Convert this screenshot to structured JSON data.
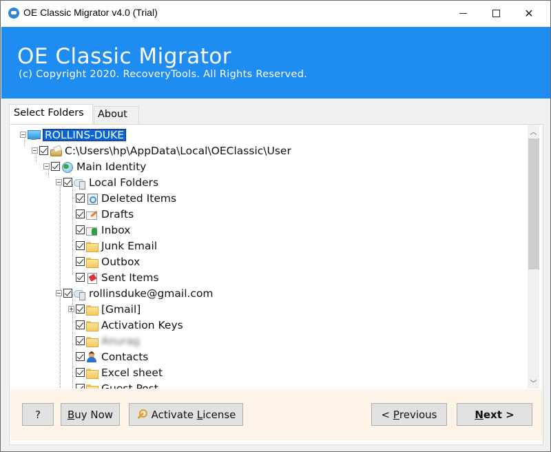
{
  "window": {
    "title": "OE Classic Migrator v4.0 (Trial)",
    "controls": [
      "minimize",
      "maximize",
      "close"
    ]
  },
  "banner": {
    "title": "OE Classic Migrator",
    "copyright": "(c) Copyright 2020. RecoveryTools. All Rights Reserved.",
    "background_color": "#1e8cf0"
  },
  "tabs": [
    {
      "label": "Select Folders",
      "active": true
    },
    {
      "label": "About",
      "active": false
    }
  ],
  "tree": {
    "root": {
      "label": "ROLLINS-DUKE",
      "icon": "computer-icon",
      "selected": true
    },
    "path": {
      "label": "C:\\Users\\hp\\AppData\\Local\\OEClassic\\User",
      "icon": "drive-icon",
      "checked": true
    },
    "identity": {
      "label": "Main Identity",
      "icon": "globe-icon",
      "checked": true
    },
    "local_folders": {
      "label": "Local Folders",
      "icon": "cloud-store-icon",
      "checked": true,
      "children": [
        {
          "label": "Deleted Items",
          "icon": "recycle-icon",
          "checked": true
        },
        {
          "label": "Drafts",
          "icon": "drafts-icon",
          "checked": true
        },
        {
          "label": "Inbox",
          "icon": "inbox-icon",
          "checked": true
        },
        {
          "label": "Junk Email",
          "icon": "folder-icon",
          "checked": true
        },
        {
          "label": "Outbox",
          "icon": "folder-icon",
          "checked": true
        },
        {
          "label": "Sent Items",
          "icon": "sent-icon",
          "checked": true
        }
      ]
    },
    "account": {
      "label": "rollinsduke@gmail.com",
      "icon": "cloud-store-icon",
      "checked": true,
      "children": [
        {
          "label": "[Gmail]",
          "icon": "folder-icon",
          "checked": true,
          "expandable": true
        },
        {
          "label": "Activation Keys",
          "icon": "folder-icon",
          "checked": true
        },
        {
          "label": "Anurag",
          "icon": "folder-icon",
          "checked": true,
          "blurred": true
        },
        {
          "label": "Contacts",
          "icon": "contact-icon",
          "checked": true
        },
        {
          "label": "Excel sheet",
          "icon": "folder-icon",
          "checked": true
        },
        {
          "label": "Guest Post",
          "icon": "folder-icon",
          "checked": true
        }
      ]
    }
  },
  "footer": {
    "help_label": "?",
    "buy_prefix": "B",
    "buy_rest": "uy Now",
    "activate_prefix": "Activate ",
    "activate_underline": "L",
    "activate_rest": "icense",
    "prev_prefix": "< ",
    "prev_underline": "P",
    "prev_rest": "revious",
    "next_underline": "N",
    "next_rest": "ext >",
    "background_color": "#fdf3e6"
  }
}
